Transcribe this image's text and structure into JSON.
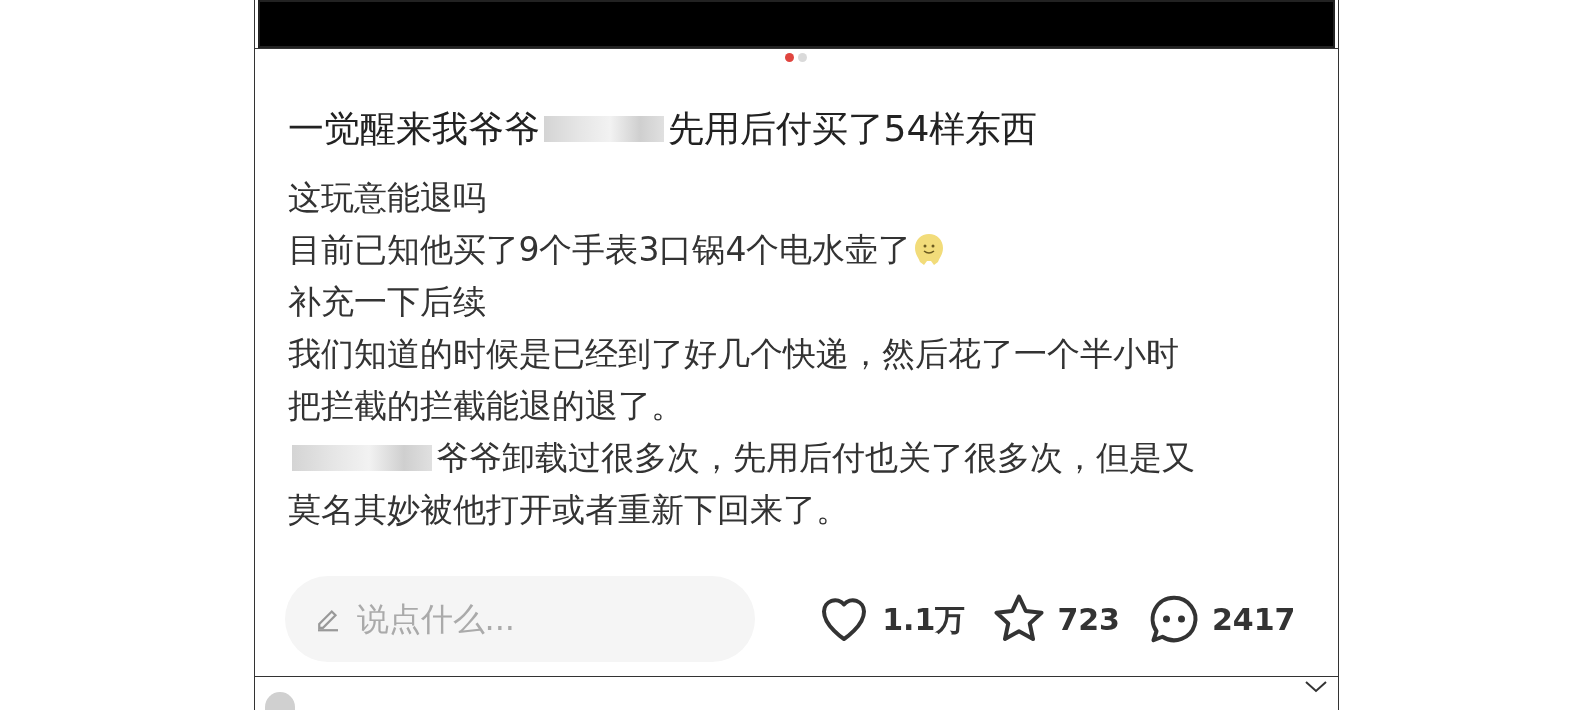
{
  "carousel_dots": [
    {
      "selected": true
    },
    {
      "selected": false
    }
  ],
  "post": {
    "title_before": "一觉醒来我爷爷",
    "title_after": "先用后付买了54样东西",
    "lines": [
      {
        "kind": "text",
        "text": "这玩意能退吗"
      },
      {
        "kind": "emoji",
        "text": "目前已知他买了9个手表3口锅4个电水壶了"
      },
      {
        "kind": "text",
        "text": "补充一下后续"
      },
      {
        "kind": "text",
        "text": "我们知道的时候是已经到了好几个快递，然后花了一个半小时"
      },
      {
        "kind": "text",
        "text": "把拦截的拦截能退的退了。"
      },
      {
        "kind": "redacted",
        "text": "爷爷卸载过很多次，先用后付也关了很多次，但是又"
      },
      {
        "kind": "text",
        "text": "莫名其妙被他打开或者重新下回来了。"
      }
    ]
  },
  "comment_field": {
    "placeholder": "说点什么..."
  },
  "actions": [
    {
      "kind": "like",
      "count": "1.1万"
    },
    {
      "kind": "star",
      "count": "723"
    },
    {
      "kind": "comment",
      "count": "2417"
    }
  ]
}
